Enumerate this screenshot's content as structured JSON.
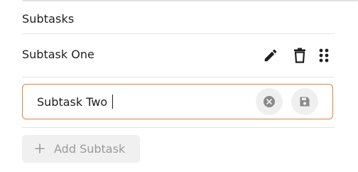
{
  "section": {
    "title": "Subtasks"
  },
  "subtasks": [
    {
      "label": "Subtask One"
    }
  ],
  "editing": {
    "value": "Subtask Two"
  },
  "add_button": {
    "label": "Add Subtask"
  },
  "icons": {
    "edit": "pencil-icon",
    "delete": "trash-icon",
    "drag": "drag-handle-icon",
    "cancel": "x-circle-icon",
    "save": "floppy-disk-icon",
    "add": "plus-icon"
  },
  "colors": {
    "focus_border": "#e0823a",
    "icon_dark": "#1f1f1f",
    "icon_muted": "#8a8a8a",
    "disabled_text": "#9a9a9a"
  }
}
